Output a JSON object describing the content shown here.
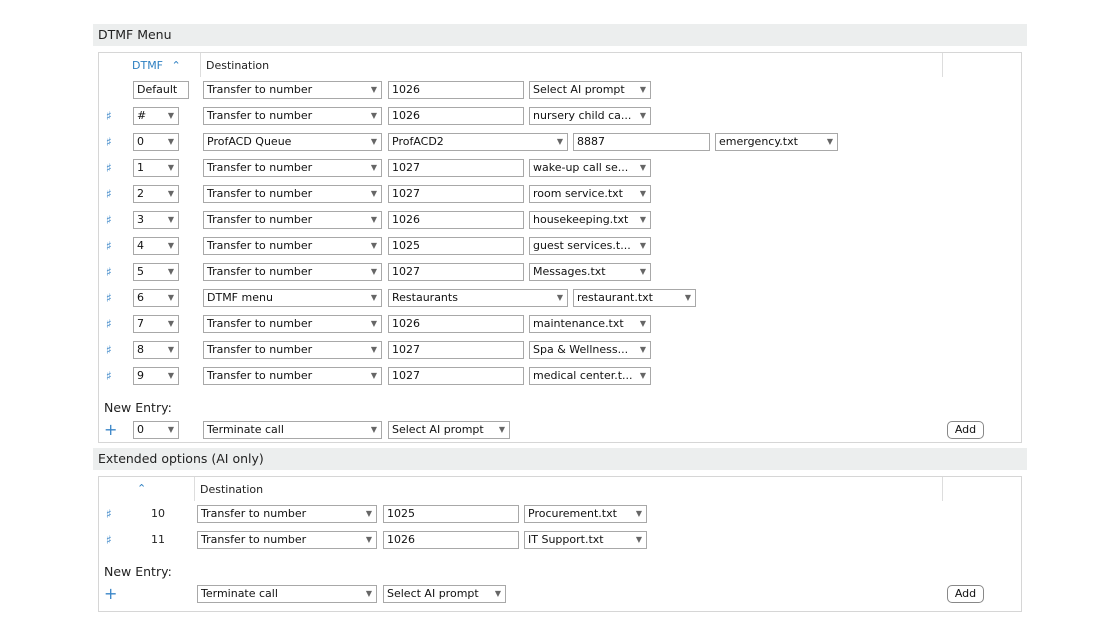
{
  "dtmf_panel": {
    "title": "DTMF Menu",
    "col_dtmf": "DTMF",
    "sort_icon": "caret-up-icon",
    "col_destination": "Destination",
    "default_label": "Default",
    "default_row": {
      "action": "Transfer to number",
      "number": "1026",
      "prompt": "Select AI prompt"
    },
    "rows": [
      {
        "key": "#",
        "action": "Transfer to number",
        "number": "1026",
        "prompt": "nursery child ca..."
      },
      {
        "key": "0",
        "action": "ProfACD Queue",
        "queue": "ProfACD2",
        "number": "8887",
        "prompt": "emergency.txt"
      },
      {
        "key": "1",
        "action": "Transfer to number",
        "number": "1027",
        "prompt": "wake-up call se..."
      },
      {
        "key": "2",
        "action": "Transfer to number",
        "number": "1027",
        "prompt": "room service.txt"
      },
      {
        "key": "3",
        "action": "Transfer to number",
        "number": "1026",
        "prompt": "housekeeping.txt"
      },
      {
        "key": "4",
        "action": "Transfer to number",
        "number": "1025",
        "prompt": "guest services.t..."
      },
      {
        "key": "5",
        "action": "Transfer to number",
        "number": "1027",
        "prompt": "Messages.txt"
      },
      {
        "key": "6",
        "action": "DTMF menu",
        "menu": "Restaurants",
        "prompt": "restaurant.txt"
      },
      {
        "key": "7",
        "action": "Transfer to number",
        "number": "1026",
        "prompt": "maintenance.txt"
      },
      {
        "key": "8",
        "action": "Transfer to number",
        "number": "1027",
        "prompt": "Spa & Wellness..."
      },
      {
        "key": "9",
        "action": "Transfer to number",
        "number": "1027",
        "prompt": "medical center.t..."
      }
    ],
    "new_entry": {
      "label": "New Entry:",
      "key": "0",
      "action": "Terminate call",
      "prompt": "Select AI prompt",
      "add_label": "Add"
    }
  },
  "extended_panel": {
    "title": "Extended options (AI only)",
    "sort_icon": "caret-up-icon",
    "col_destination": "Destination",
    "rows": [
      {
        "key": "10",
        "action": "Transfer to number",
        "number": "1025",
        "prompt": "Procurement.txt"
      },
      {
        "key": "11",
        "action": "Transfer to number",
        "number": "1026",
        "prompt": "IT Support.txt"
      }
    ],
    "new_entry": {
      "label": "New Entry:",
      "action": "Terminate call",
      "prompt": "Select AI prompt",
      "add_label": "Add"
    }
  },
  "icons": {
    "row_handle": "hash-drag-icon",
    "add": "plus-icon",
    "dropdown": "triangle-down-icon"
  },
  "colors": {
    "accent": "#3b86c8",
    "header_bg": "#eceeee",
    "border": "#d6d6d6"
  }
}
